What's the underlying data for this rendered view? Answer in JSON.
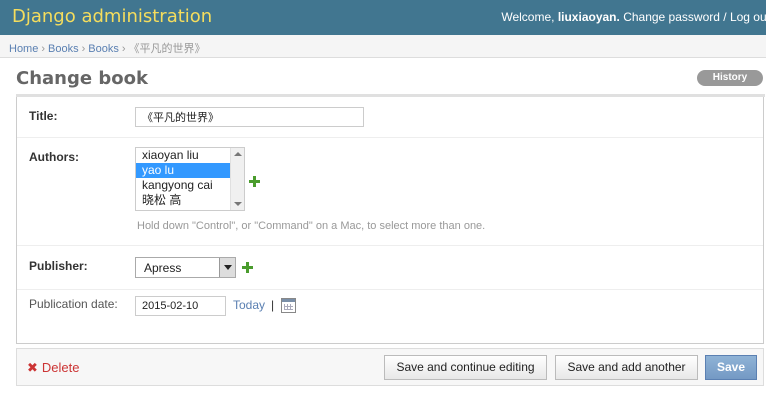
{
  "header": {
    "site_name": "Django administration",
    "welcome": "Welcome,",
    "username": "liuxiaoyan.",
    "change_password": "Change password",
    "separator": "/",
    "logout": "Log out"
  },
  "breadcrumbs": {
    "home": "Home",
    "app": "Books",
    "model": "Books",
    "current": "《平凡的世界》",
    "sep": "›"
  },
  "page": {
    "title": "Change book",
    "history": "History"
  },
  "form": {
    "title": {
      "label": "Title:",
      "value": "《平凡的世界》"
    },
    "authors": {
      "label": "Authors:",
      "options": [
        "xiaoyan liu",
        "yao lu",
        "kangyong cai",
        "晓松 高"
      ],
      "selected": "yao lu",
      "help": "Hold down \"Control\", or \"Command\" on a Mac, to select more than one."
    },
    "publisher": {
      "label": "Publisher:",
      "value": "Apress"
    },
    "publication_date": {
      "label": "Publication date:",
      "value": "2015-02-10",
      "today": "Today",
      "pipe": "|"
    }
  },
  "submit": {
    "delete": "Delete",
    "delete_icon": "✖",
    "save_continue": "Save and continue editing",
    "save_another": "Save and add another",
    "save": "Save"
  },
  "colors": {
    "header_bg": "#417690",
    "site_name": "#f5dd5d",
    "link": "#5b80b2",
    "delete": "#cc3434",
    "selected_option": "#3399ff",
    "add_icon": "#4a9c2d"
  }
}
